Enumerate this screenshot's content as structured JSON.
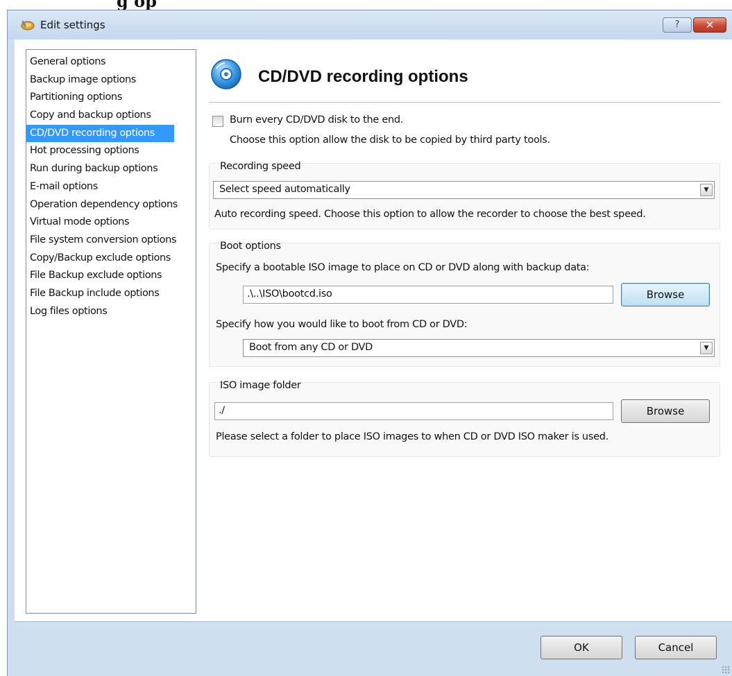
{
  "window": {
    "title": "Edit settings",
    "help_label": "?",
    "close_label": "✕"
  },
  "nav": {
    "items": [
      {
        "label": "General options",
        "selected": false
      },
      {
        "label": "Backup image options",
        "selected": false
      },
      {
        "label": "Partitioning options",
        "selected": false
      },
      {
        "label": "Copy and backup options",
        "selected": false
      },
      {
        "label": "CD/DVD recording options",
        "selected": true
      },
      {
        "label": "Hot processing options",
        "selected": false
      },
      {
        "label": "Run during backup options",
        "selected": false
      },
      {
        "label": "E-mail options",
        "selected": false
      },
      {
        "label": "Operation dependency options",
        "selected": false
      },
      {
        "label": "Virtual mode options",
        "selected": false
      },
      {
        "label": "File system conversion options",
        "selected": false
      },
      {
        "label": "Copy/Backup exclude options",
        "selected": false
      },
      {
        "label": "File Backup exclude options",
        "selected": false
      },
      {
        "label": "File Backup include options",
        "selected": false
      },
      {
        "label": "Log files options",
        "selected": false
      }
    ]
  },
  "page": {
    "title": "CD/DVD recording options",
    "icon": "cd-disc-icon"
  },
  "burn": {
    "label": "Burn every CD/DVD disk to the end.",
    "checked": false,
    "hint": "Choose this option allow the disk to be copied by third party tools."
  },
  "recording_speed": {
    "group_title": "Recording speed",
    "selected": "Select speed automatically",
    "description": "Auto recording speed. Choose this option to allow the recorder to choose the best speed."
  },
  "boot_options": {
    "group_title": "Boot options",
    "iso_prompt": "Specify a bootable ISO image to place on CD or DVD along with backup data:",
    "iso_path": ".\\..\\ISO\\bootcd.iso",
    "browse_label": "Browse",
    "boot_prompt": "Specify how you would like to boot from CD or DVD:",
    "boot_selected": "Boot from any CD or DVD"
  },
  "iso_folder": {
    "group_title": "ISO image folder",
    "path": "./",
    "browse_label": "Browse",
    "description": "Please select a folder to place ISO images to when CD or DVD ISO maker is used."
  },
  "footer": {
    "ok_label": "OK",
    "cancel_label": "Cancel"
  },
  "colors": {
    "selection": "#3399ff",
    "frame": "#cfdff0",
    "close_button": "#c84a36"
  }
}
